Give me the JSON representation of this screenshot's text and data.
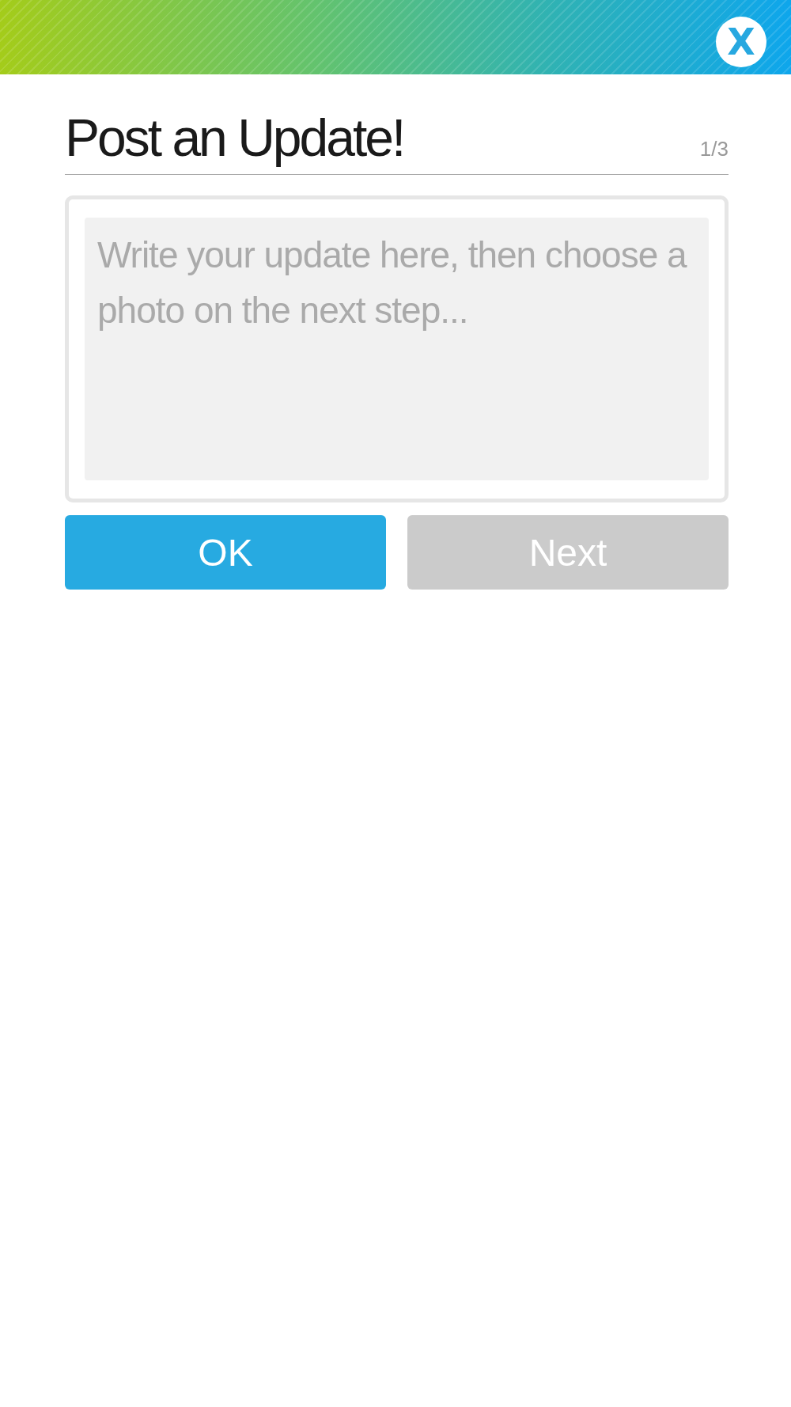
{
  "header": {
    "close_button": {
      "label": "X"
    }
  },
  "title": "Post an Update!",
  "step": "1/3",
  "update_field": {
    "placeholder": "Write your update here, then choose a photo on the next step..."
  },
  "buttons": [
    {
      "label": "OK",
      "disabled": false
    },
    {
      "label": "Next",
      "disabled": true
    }
  ]
}
